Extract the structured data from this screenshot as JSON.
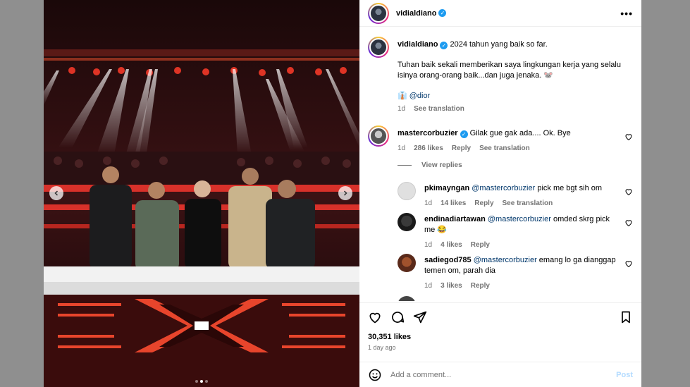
{
  "post": {
    "username": "vidialdiano",
    "more_icon": "more-horizontal-icon"
  },
  "caption": {
    "username": "vidialdiano",
    "line1": "2024 tahun yang baik so far.",
    "line2": "Tuhan baik sekali memberikan saya lingkungan kerja yang selalu isinya orang-orang baik...dan juga jenaka. 🐭",
    "tag": "👔 @dior",
    "time": "1d",
    "see_translation": "See translation"
  },
  "comments": [
    {
      "username": "mastercorbuzier",
      "verified": true,
      "text": "Gilak gue gak ada.... Ok. Bye",
      "time": "1d",
      "likes": "286 likes",
      "reply": "Reply",
      "see_translation": "See translation"
    }
  ],
  "view_replies": "View replies",
  "replies": [
    {
      "username": "pkimayngan",
      "mention": "@mastercorbuzier",
      "text": "pick me bgt sih om",
      "time": "1d",
      "likes": "14 likes",
      "reply": "Reply",
      "see_translation": "See translation"
    },
    {
      "username": "endinadiartawan",
      "mention": "@mastercorbuzier",
      "text": "omded skrg pick me 😂",
      "time": "1d",
      "likes": "4 likes",
      "reply": "Reply"
    },
    {
      "username": "sadiegod785",
      "mention": "@mastercorbuzier",
      "text": "emang lo ga dianggap temen om, parah dia",
      "time": "1d",
      "likes": "3 likes",
      "reply": "Reply"
    }
  ],
  "actions": {
    "likes": "30,351 likes",
    "ago": "1 day ago"
  },
  "add_comment": {
    "placeholder": "Add a comment...",
    "post_label": "Post"
  },
  "carousel": {
    "dots": 3,
    "active_dot": 2
  }
}
